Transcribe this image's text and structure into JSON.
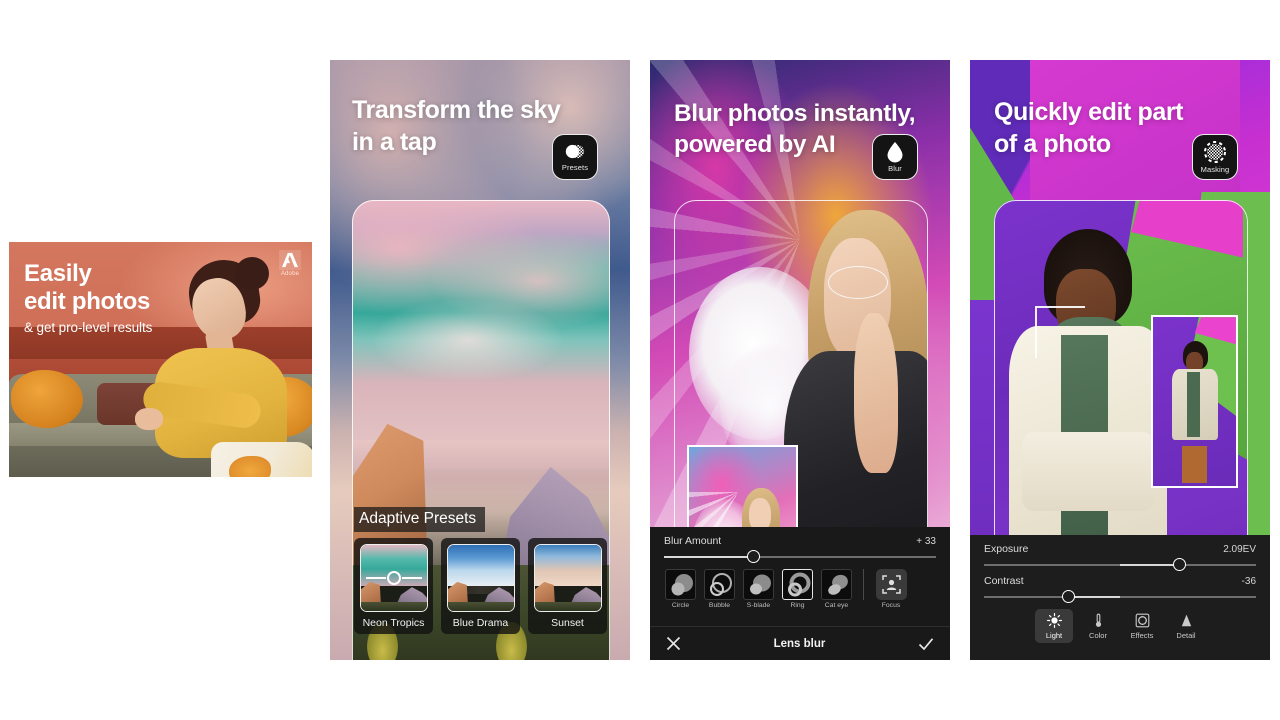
{
  "banner": {
    "headline_line1": "Easily",
    "headline_line2": "edit photos",
    "subhead": "& get pro-level results",
    "brand": "Adobe",
    "brand_icon": "adobe-logo-icon"
  },
  "panels": [
    {
      "id": "panel2",
      "headline_line1": "Transform the sky",
      "headline_line2": "in a tap",
      "tool_chip": {
        "label": "Presets",
        "icon": "presets-icon"
      },
      "section_label": "Adaptive Presets",
      "presets": [
        {
          "name": "Neon Tropics",
          "selected": true
        },
        {
          "name": "Blue Drama",
          "selected": false
        },
        {
          "name": "Sunset",
          "selected": false
        }
      ]
    },
    {
      "id": "panel3",
      "headline_line1": "Blur photos instantly,",
      "headline_line2": "powered by AI",
      "tool_chip": {
        "label": "Blur",
        "icon": "blur-droplet-icon"
      },
      "slider": {
        "label": "Blur Amount",
        "value": "+ 33",
        "position_pct": 33
      },
      "shapes": [
        {
          "name": "Circle",
          "selected": false
        },
        {
          "name": "Bubble",
          "selected": false
        },
        {
          "name": "S-blade",
          "selected": false
        },
        {
          "name": "Ring",
          "selected": true
        },
        {
          "name": "Cat eye",
          "selected": false
        }
      ],
      "focus": {
        "name": "Focus",
        "icon": "focus-subject-icon"
      },
      "footer": {
        "title": "Lens blur",
        "cancel_icon": "close-icon",
        "confirm_icon": "check-icon"
      }
    },
    {
      "id": "panel4",
      "headline_line1": "Quickly edit part",
      "headline_line2": "of a photo",
      "tool_chip": {
        "label": "Masking",
        "icon": "masking-icon"
      },
      "sliders": [
        {
          "label": "Exposure",
          "value": "2.09EV",
          "position_pct": 72
        },
        {
          "label": "Contrast",
          "value": "-36",
          "position_pct": 31
        }
      ],
      "modes": [
        {
          "name": "Light",
          "icon": "sun-icon",
          "selected": true
        },
        {
          "name": "Color",
          "icon": "thermometer-icon",
          "selected": false
        },
        {
          "name": "Effects",
          "icon": "effects-circle-icon",
          "selected": false
        },
        {
          "name": "Detail",
          "icon": "triangle-detail-icon",
          "selected": false
        }
      ]
    }
  ],
  "colors": {
    "banner_bg": "#cf6f58",
    "editor_bg": "#1d1d1d",
    "accent_white": "#ffffff",
    "panel4_purple": "#7c33cc",
    "panel4_green": "#6ec04f",
    "panel4_magenta": "#d63ad0"
  }
}
